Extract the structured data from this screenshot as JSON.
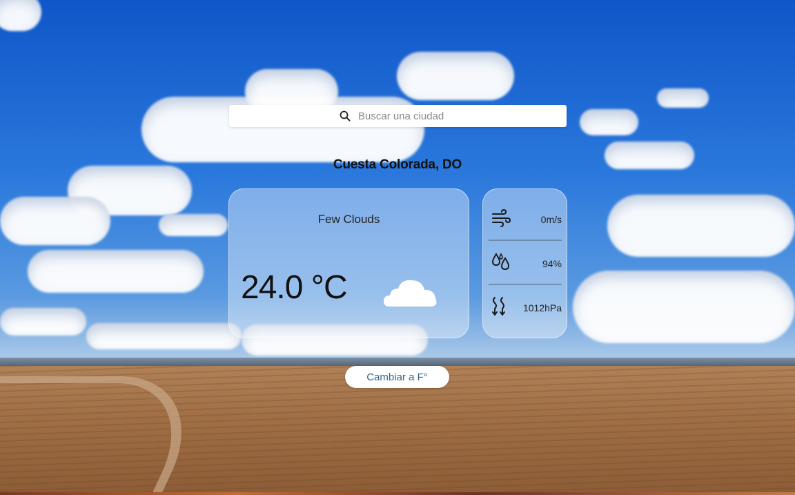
{
  "search": {
    "placeholder": "Buscar una ciudad",
    "icon": "search-icon"
  },
  "location": {
    "name": "Cuesta Colorada, DO"
  },
  "current": {
    "description": "Few Clouds",
    "temperature": "24.0 °C",
    "icon": "cloud-icon"
  },
  "stats": [
    {
      "icon": "wind-icon",
      "value": "0m/s"
    },
    {
      "icon": "humidity-icon",
      "value": "94%"
    },
    {
      "icon": "pressure-icon",
      "value": "1012hPa"
    }
  ],
  "units_toggle": {
    "label": "Cambiar a F°"
  }
}
